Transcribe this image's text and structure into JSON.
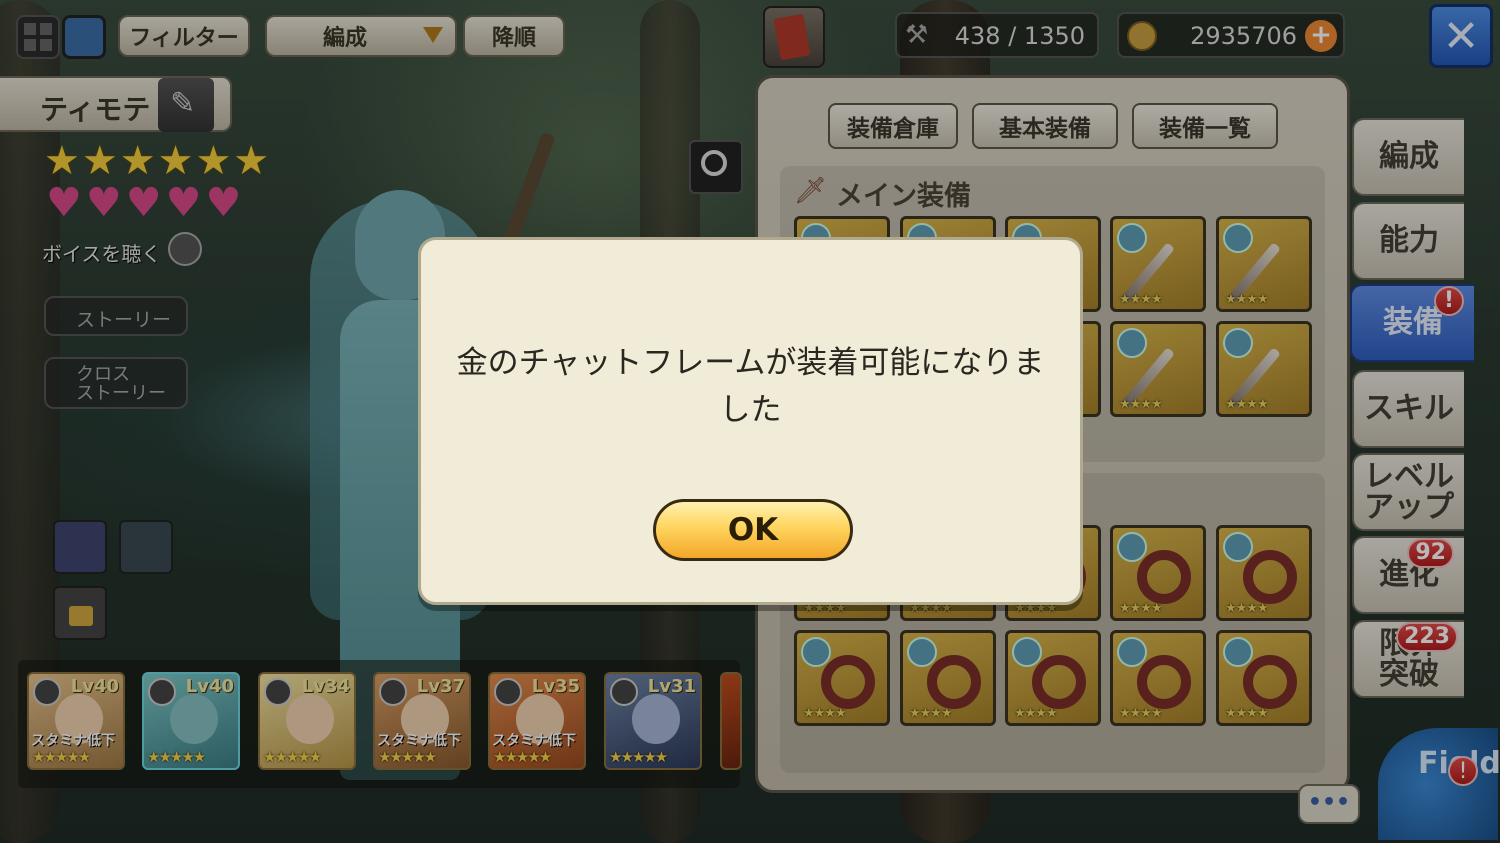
{
  "topbar": {
    "filter_label": "フィルター",
    "sort_select": "編成",
    "order_label": "降順",
    "stamina": "438 / 1350",
    "coins": "2935706",
    "plus_glyph": "+",
    "close_glyph": "✕"
  },
  "character": {
    "name": "ティモテ",
    "stars": "★★★★★★",
    "hearts": "♥♥♥♥♥",
    "voice_label": "ボイスを聴く",
    "story_label": "ストーリー",
    "cross_story_label": "クロス\nストーリー"
  },
  "equip": {
    "tabs": [
      "装備倉庫",
      "基本装備",
      "装備一覧"
    ],
    "main_section": "メイン装備",
    "item_stars": "★★★★"
  },
  "side_tabs": [
    {
      "label": "編成"
    },
    {
      "label": "能力"
    },
    {
      "label": "装備",
      "badge": "!"
    },
    {
      "label": "スキル"
    },
    {
      "label": "レベル\nアップ"
    },
    {
      "label": "進化",
      "badge": "92"
    },
    {
      "label": "限界\n突破",
      "badge": "223"
    }
  ],
  "roster": [
    {
      "lv": "Lv40",
      "status": "スタミナ低下",
      "stars": "★★★★★"
    },
    {
      "lv": "Lv40",
      "status": "",
      "stars": "★★★★★"
    },
    {
      "lv": "Lv34",
      "status": "",
      "stars": "★★★★★"
    },
    {
      "lv": "Lv37",
      "status": "スタミナ低下",
      "stars": "★★★★★"
    },
    {
      "lv": "Lv35",
      "status": "スタミナ低下",
      "stars": "★★★★★"
    },
    {
      "lv": "Lv31",
      "status": "",
      "stars": "★★★★★"
    }
  ],
  "field_label": "Field",
  "field_badge": "!",
  "chat_glyph": "•••",
  "dialog": {
    "message": "金のチャットフレームが装着可能になりました",
    "ok_label": "OK"
  },
  "colors": {
    "dialog_bg": "#f1ecd8",
    "ok_button": "#ffd55e",
    "active_tab": "#2f5fc0",
    "badge": "#b21d1d"
  }
}
